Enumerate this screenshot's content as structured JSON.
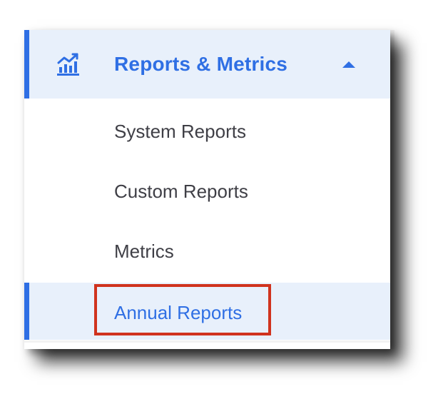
{
  "menu": {
    "header": {
      "icon": "chart-up-icon",
      "title": "Reports & Metrics",
      "expand_icon": "caret-up-icon"
    },
    "items": [
      {
        "label": "System Reports",
        "active": false
      },
      {
        "label": "Custom Reports",
        "active": false
      },
      {
        "label": "Metrics",
        "active": false
      },
      {
        "label": "Annual Reports",
        "active": true
      }
    ]
  },
  "colors": {
    "accent": "#2f6fe4",
    "header_bg": "#e8f0fb",
    "text": "#3f3f46",
    "highlight_border": "#d0331e"
  }
}
